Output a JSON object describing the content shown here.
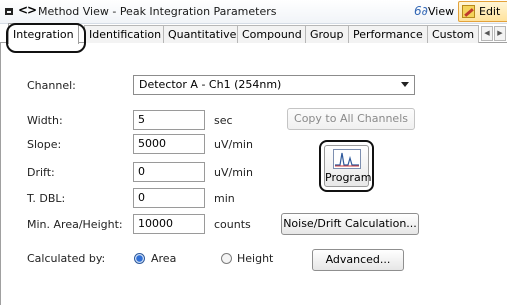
{
  "titlebar": {
    "title": "Method View - Peak Integration Parameters",
    "view_label": "View",
    "edit_label": "Edit"
  },
  "tabs": [
    {
      "label": "Integration"
    },
    {
      "label": "Identification"
    },
    {
      "label": "Quantitative"
    },
    {
      "label": "Compound"
    },
    {
      "label": "Group"
    },
    {
      "label": "Performance"
    },
    {
      "label": "Custom"
    }
  ],
  "form": {
    "channel": {
      "label": "Channel:",
      "value": "Detector A - Ch1 (254nm)"
    },
    "width": {
      "label": "Width:",
      "value": "5",
      "unit": "sec"
    },
    "slope": {
      "label": "Slope:",
      "value": "5000",
      "unit": "uV/min"
    },
    "drift": {
      "label": "Drift:",
      "value": "0",
      "unit": "uV/min"
    },
    "tdbl": {
      "label": "T. DBL:",
      "value": "0",
      "unit": "min"
    },
    "min_area": {
      "label": "Min. Area/Height:",
      "value": "10000",
      "unit": "counts"
    },
    "calculated_by": {
      "label": "Calculated by:",
      "option_area": "Area",
      "option_height": "Height",
      "selected": "Area"
    }
  },
  "buttons": {
    "copy_all": "Copy to All Channels",
    "program": "Program",
    "noise_drift": "Noise/Drift Calculation...",
    "advanced": "Advanced..."
  },
  "colors": {
    "accent": "#2f6fd6",
    "edit_bg": "#ffe39c",
    "highlight_border": "#111111"
  }
}
